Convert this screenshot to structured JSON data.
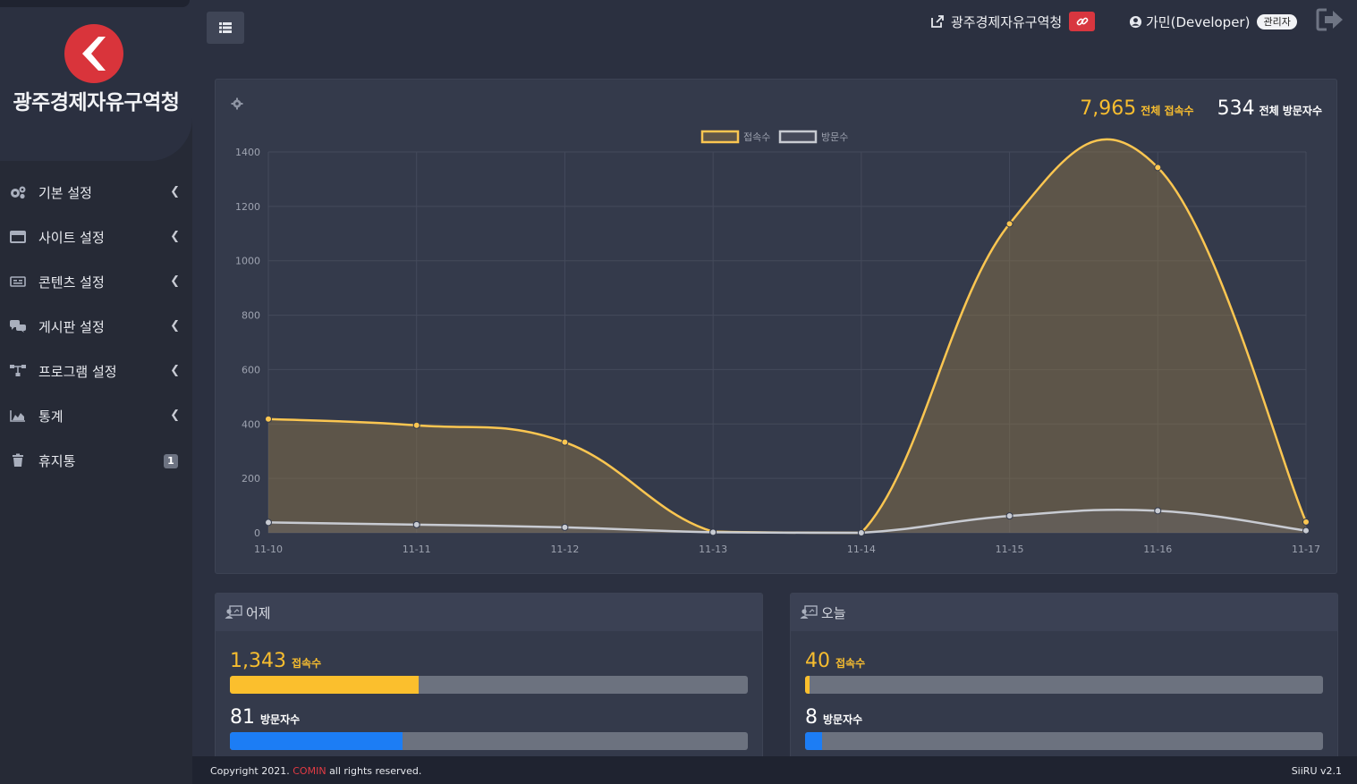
{
  "sidebar": {
    "org_title": "광주경제자유구역청",
    "items": [
      {
        "label": "기본 설정",
        "icon": "cogs-icon"
      },
      {
        "label": "사이트 설정",
        "icon": "window-icon"
      },
      {
        "label": "콘텐츠 설정",
        "icon": "content-icon"
      },
      {
        "label": "게시판 설정",
        "icon": "comments-icon"
      },
      {
        "label": "프로그램 설정",
        "icon": "sitemap-icon"
      },
      {
        "label": "통계",
        "icon": "area-chart-icon"
      },
      {
        "label": "휴지통",
        "icon": "trash-icon",
        "badge": "1"
      }
    ]
  },
  "header": {
    "site_name": "광주경제자유구역청",
    "user_name": "가민(Developer)",
    "role": "관리자"
  },
  "totals": {
    "access_value": "7,965",
    "access_label": "전체 접속수",
    "visitor_value": "534",
    "visitor_label": "전체 방문자수"
  },
  "chart_data": {
    "type": "area",
    "categories": [
      "11-10",
      "11-11",
      "11-12",
      "11-13",
      "11-14",
      "11-15",
      "11-16",
      "11-17"
    ],
    "series": [
      {
        "name": "접속수",
        "values": [
          418,
          395,
          333,
          4,
          0,
          1136,
          1343,
          40
        ],
        "color": "#fbc651"
      },
      {
        "name": "방문자수",
        "values": [
          38,
          30,
          20,
          2,
          0,
          62,
          81,
          8
        ],
        "color": "#c8cbd2"
      }
    ],
    "legend": [
      "접속수",
      "방문수"
    ],
    "legend_position": "top-center",
    "ylim": [
      0,
      1400
    ],
    "yticks": [
      0,
      200,
      400,
      600,
      800,
      1000,
      1200,
      1400
    ],
    "grid": true
  },
  "yesterday": {
    "title": "어제",
    "access_value": "1,343",
    "access_label": "접속수",
    "access_ratio": 0.365,
    "visitor_value": "81",
    "visitor_label": "방문자수",
    "visitor_ratio": 0.333
  },
  "today": {
    "title": "오늘",
    "access_value": "40",
    "access_label": "접속수",
    "access_ratio": 0.009,
    "visitor_value": "8",
    "visitor_label": "방문자수",
    "visitor_ratio": 0.032
  },
  "footer": {
    "copy_prefix": "Copyright 2021.",
    "brand": "COMIN",
    "copy_suffix": "all rights reserved.",
    "version": "SiiRU v2.1"
  }
}
